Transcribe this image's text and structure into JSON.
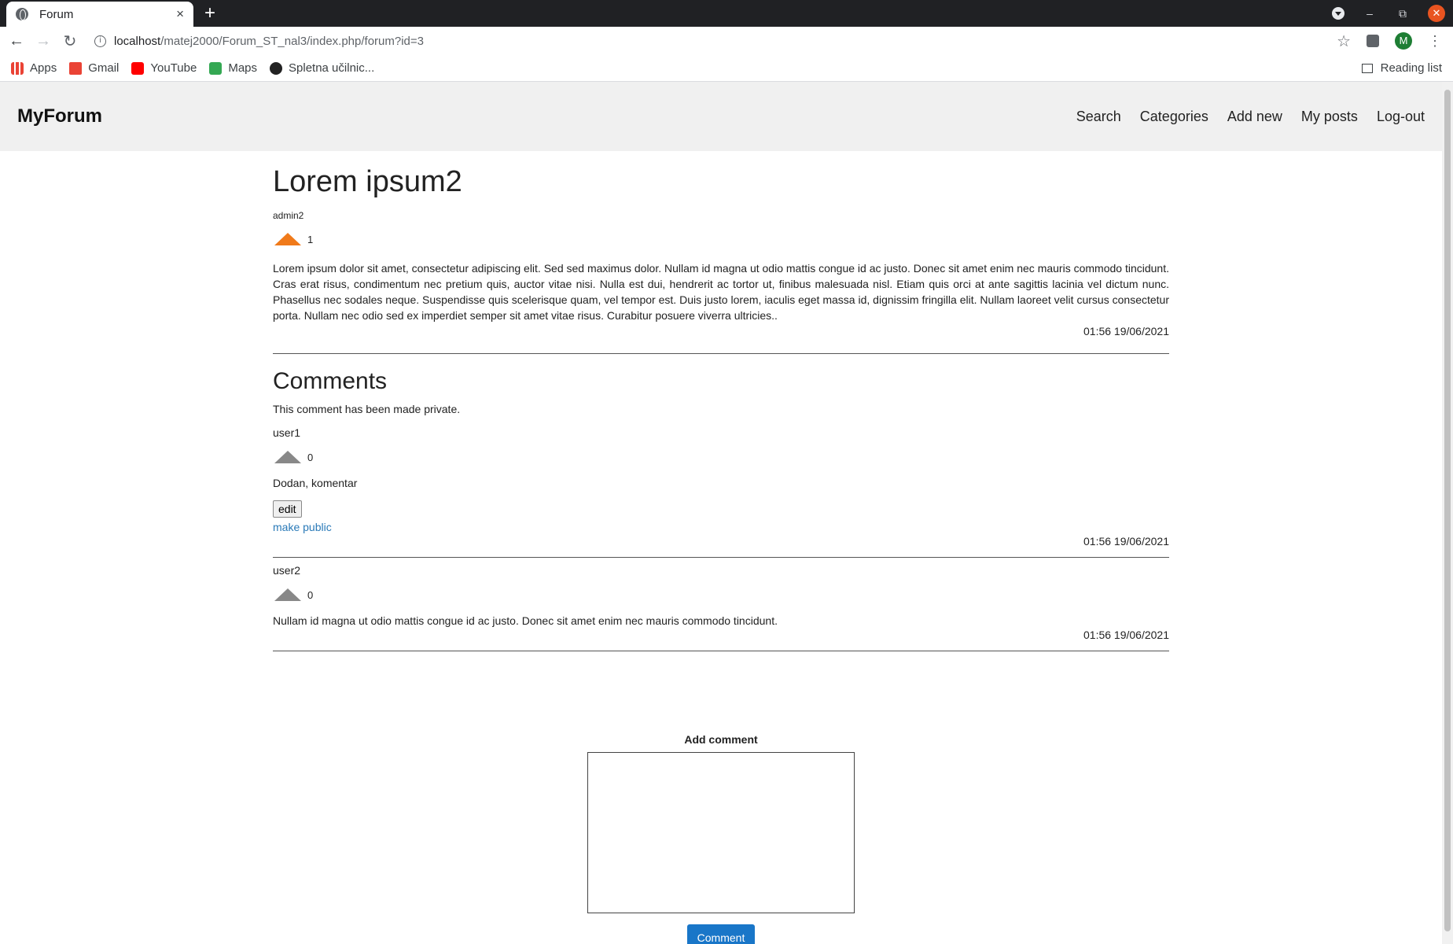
{
  "browser": {
    "tab_title": "Forum",
    "url_host": "localhost",
    "url_path": "/matej2000/Forum_ST_nal3/index.php/forum?id=3",
    "avatar_letter": "M",
    "bookmarks": [
      "Apps",
      "Gmail",
      "YouTube",
      "Maps",
      "Spletna učilnic..."
    ],
    "reading_list": "Reading list"
  },
  "site": {
    "brand": "MyForum",
    "nav": [
      "Search",
      "Categories",
      "Add new",
      "My posts",
      "Log-out"
    ]
  },
  "post": {
    "title": "Lorem ipsum2",
    "author": "admin2",
    "votes": "1",
    "body": "Lorem ipsum dolor sit amet, consectetur adipiscing elit. Sed sed maximus dolor. Nullam id magna ut odio mattis congue id ac justo. Donec sit amet enim nec mauris commodo tincidunt. Cras erat risus, condimentum nec pretium quis, auctor vitae nisi. Nulla est dui, hendrerit ac tortor ut, finibus malesuada nisl. Etiam quis orci at ante sagittis lacinia vel dictum nunc. Phasellus nec sodales neque. Suspendisse quis scelerisque quam, vel tempor est. Duis justo lorem, iaculis eget massa id, dignissim fringilla elit. Nullam laoreet velit cursus consectetur porta. Nullam nec odio sed ex imperdiet semper sit amet vitae risus. Curabitur posuere viverra ultricies..",
    "timestamp": "01:56 19/06/2021"
  },
  "comments": {
    "title": "Comments",
    "private_note": "This comment has been made private.",
    "items": [
      {
        "user": "user1",
        "votes": "0",
        "text": "Dodan, komentar",
        "edit_label": "edit",
        "make_public_label": "make public",
        "timestamp": "01:56 19/06/2021"
      },
      {
        "user": "user2",
        "votes": "0",
        "text": "Nullam id magna ut odio mattis congue id ac justo. Donec sit amet enim nec mauris commodo tincidunt.",
        "timestamp": "01:56 19/06/2021"
      }
    ]
  },
  "add_comment": {
    "label": "Add comment",
    "button": "Comment"
  },
  "colors": {
    "upvoted": "#f07a1a",
    "vote_neutral": "#888888",
    "link": "#2a7ab8",
    "button": "#1976c8"
  }
}
